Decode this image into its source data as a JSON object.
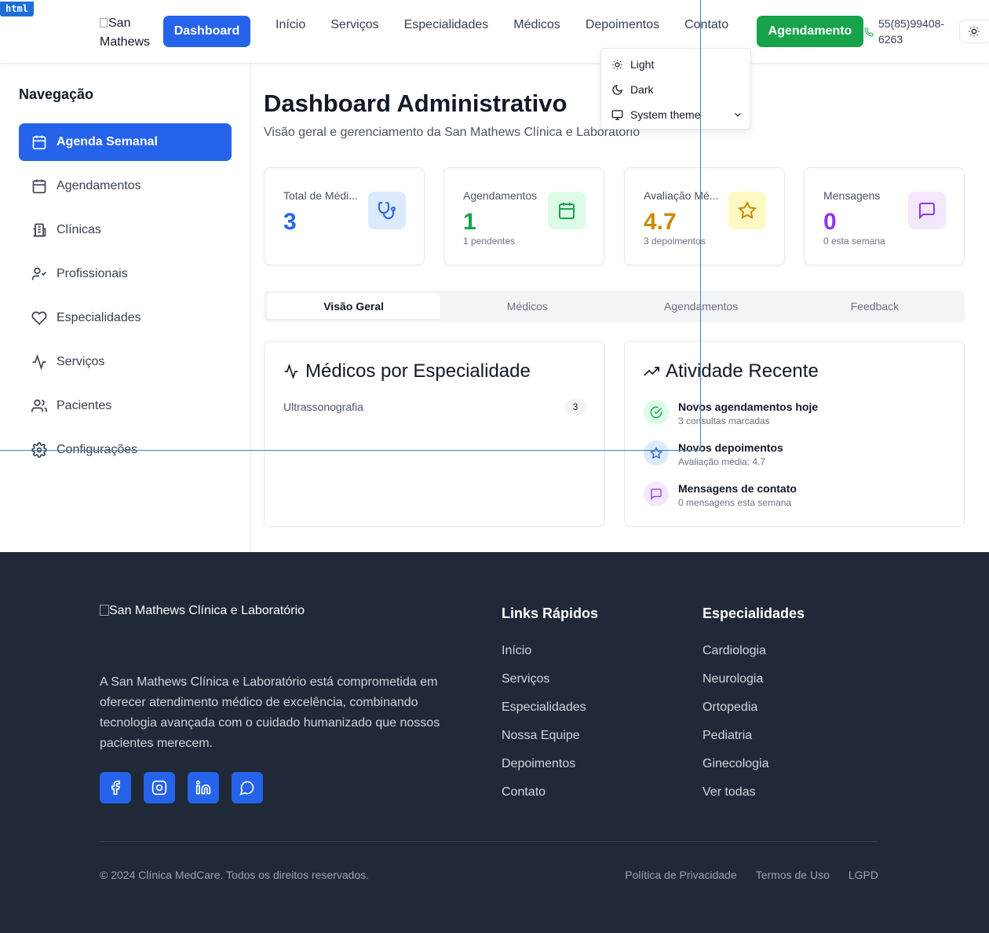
{
  "dev_tag": "html",
  "header": {
    "logo_alt": "San Mathews",
    "dashboard_label": "Dashboard",
    "nav": [
      "Início",
      "Serviços",
      "Especialidades",
      "Médicos",
      "Depoimentos",
      "Contato"
    ],
    "cta_label": "Agendamento",
    "phone": "55(85)99408-6263"
  },
  "theme_menu": {
    "items": [
      "Light",
      "Dark",
      "System theme"
    ]
  },
  "sidebar": {
    "title": "Navegação",
    "items": [
      {
        "label": "Agenda Semanal",
        "icon": "calendar-grid-icon",
        "active": true
      },
      {
        "label": "Agendamentos",
        "icon": "calendar-icon"
      },
      {
        "label": "Clínicas",
        "icon": "building-icon"
      },
      {
        "label": "Profissionais",
        "icon": "user-check-icon"
      },
      {
        "label": "Especialidades",
        "icon": "heart-icon"
      },
      {
        "label": "Serviços",
        "icon": "activity-icon"
      },
      {
        "label": "Pacientes",
        "icon": "users-icon"
      },
      {
        "label": "Configurações",
        "icon": "gear-icon"
      }
    ]
  },
  "main": {
    "title": "Dashboard Administrativo",
    "subtitle": "Visão geral e gerenciamento da San Mathews Clínica e Laboratório",
    "stats": [
      {
        "label": "Total de Médi...",
        "value": "3",
        "sub": "",
        "color": "#2563eb",
        "bg": "#dbeafe",
        "icon": "stethoscope-icon"
      },
      {
        "label": "Agendamentos",
        "value": "1",
        "sub": "1 pendentes",
        "color": "#16a34a",
        "bg": "#dcfce7",
        "icon": "calendar-icon"
      },
      {
        "label": "Avaliação Mé...",
        "value": "4.7",
        "sub": "3 depoimentos",
        "color": "#ca8a04",
        "bg": "#fef9c3",
        "icon": "star-icon"
      },
      {
        "label": "Mensagens",
        "value": "0",
        "sub": "0 esta semana",
        "color": "#9333ea",
        "bg": "#f3e8ff",
        "icon": "message-icon"
      }
    ],
    "tabs": [
      "Visão Geral",
      "Médicos",
      "Agendamentos",
      "Feedback"
    ],
    "specialties_panel": {
      "title": "Médicos por Especialidade",
      "rows": [
        {
          "name": "Ultrassonografia",
          "count": "3"
        }
      ]
    },
    "activity_panel": {
      "title": "Atividade Recente",
      "items": [
        {
          "title": "Novos agendamentos hoje",
          "sub": "3 consultas marcadas",
          "icon": "check-circle-icon",
          "color": "#16a34a",
          "bg": "#dcfce7"
        },
        {
          "title": "Novos depoimentos",
          "sub": "Avaliação média: 4.7",
          "icon": "star-icon",
          "color": "#2563eb",
          "bg": "#dbeafe"
        },
        {
          "title": "Mensagens de contato",
          "sub": "0 mensagens esta semana",
          "icon": "message-icon",
          "color": "#9333ea",
          "bg": "#f3e8ff"
        }
      ]
    }
  },
  "footer": {
    "logo_alt": "San Mathews Clínica e Laboratório",
    "description": "A San Mathews Clínica e Laboratório está comprometida em oferecer atendimento médico de excelência, combinando tecnologia avançada com o cuidado humanizado que nossos pacientes merecem.",
    "quick_links_title": "Links Rápidos",
    "quick_links": [
      "Início",
      "Serviços",
      "Especialidades",
      "Nossa Equipe",
      "Depoimentos",
      "Contato"
    ],
    "specialties_title": "Especialidades",
    "specialties": [
      "Cardiologia",
      "Neurologia",
      "Ortopedia",
      "Pediatria",
      "Ginecologia",
      "Ver todas"
    ],
    "copyright": "© 2024 Clínica MedCare. Todos os direitos reservados.",
    "legal_links": [
      "Política de Privacidade",
      "Termos de Uso",
      "LGPD"
    ]
  }
}
